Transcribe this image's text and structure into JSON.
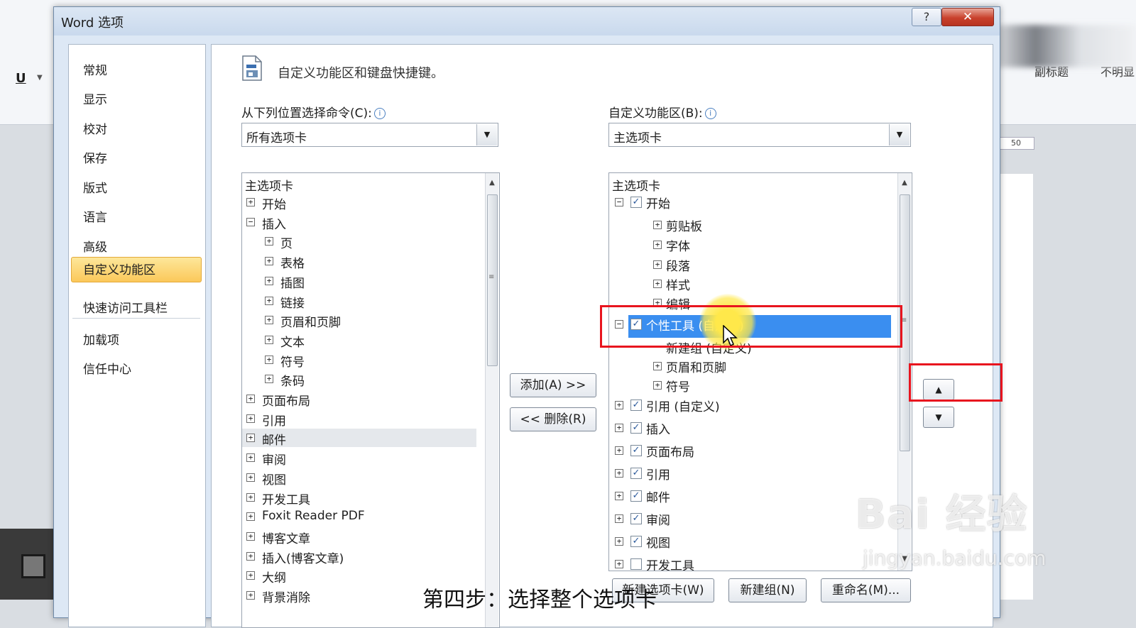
{
  "background": {
    "underline_button": "U",
    "style_1": "副标题",
    "style_2": "不明显",
    "ruler_value": "50"
  },
  "dialog": {
    "title": "Word 选项",
    "help_label": "?",
    "close_label": "✕"
  },
  "nav": {
    "items": [
      "常规",
      "显示",
      "校对",
      "保存",
      "版式",
      "语言",
      "高级",
      "自定义功能区",
      "快速访问工具栏",
      "加载项",
      "信任中心"
    ],
    "active": "自定义功能区"
  },
  "header": {
    "text": "自定义功能区和键盘快捷键。"
  },
  "left": {
    "label": "从下列位置选择命令(C):",
    "combo_value": "所有选项卡",
    "tree_header": "主选项卡",
    "rows": [
      "开始",
      "插入",
      "页",
      "表格",
      "插图",
      "链接",
      "页眉和页脚",
      "文本",
      "符号",
      "条码",
      "页面布局",
      "引用",
      "邮件",
      "审阅",
      "视图",
      "开发工具",
      "Foxit Reader PDF",
      "博客文章",
      "插入(博客文章)",
      "大纲",
      "背景消除"
    ]
  },
  "middle": {
    "add_label": "添加(A) >>",
    "remove_label": "<< 删除(R)"
  },
  "right": {
    "label": "自定义功能区(B):",
    "combo_value": "主选项卡",
    "tree_header": "主选项卡",
    "rows": [
      "开始",
      "剪贴板",
      "字体",
      "段落",
      "样式",
      "编辑",
      "个性工具 (自定义)",
      "新建组 (自定义)",
      "页眉和页脚",
      "符号",
      "引用 (自定义)",
      "插入",
      "页面布局",
      "引用",
      "邮件",
      "审阅",
      "视图",
      "开发工具"
    ],
    "selected": "个性工具 (自定义)"
  },
  "bottom_buttons": {
    "new_tab": "新建选项卡(W)",
    "new_group": "新建组(N)",
    "rename": "重命名(M)..."
  },
  "caption": "第四步：选择整个选项卡",
  "watermark": {
    "big": "Bai 经验",
    "small": "jingyan.baidu.com"
  },
  "colors": {
    "highlight": "#e8141e",
    "selection": "#3a8ef0",
    "active_nav": "#fbc85a"
  }
}
